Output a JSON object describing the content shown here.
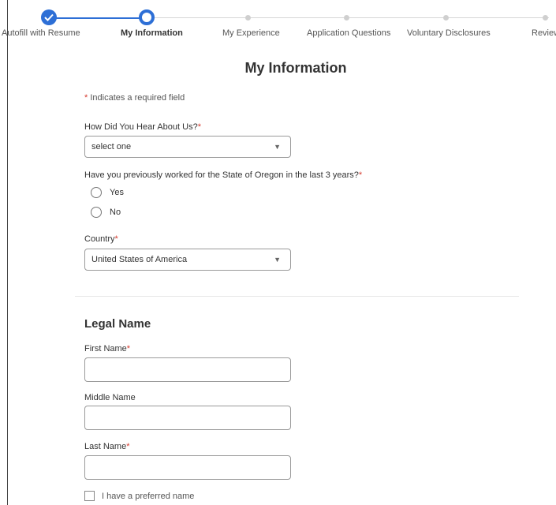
{
  "stepper": {
    "steps": [
      {
        "label": "Autofill with Resume",
        "state": "done"
      },
      {
        "label": "My Information",
        "state": "current"
      },
      {
        "label": "My Experience",
        "state": "upcoming"
      },
      {
        "label": "Application Questions",
        "state": "upcoming"
      },
      {
        "label": "Voluntary Disclosures",
        "state": "upcoming"
      },
      {
        "label": "Review",
        "state": "upcoming"
      }
    ],
    "accent_color": "#2d6fd6"
  },
  "page": {
    "title": "My Information",
    "required_star": "*",
    "required_note": "Indicates a required field"
  },
  "fields": {
    "hear_about": {
      "label": "How Did You Hear About Us?",
      "value": "select one"
    },
    "worked_oregon": {
      "label": "Have you previously worked for the State of Oregon in the last 3 years?",
      "options": [
        "Yes",
        "No"
      ]
    },
    "country": {
      "label": "Country",
      "value": "United States of America"
    }
  },
  "legal_name": {
    "title": "Legal Name",
    "first_name_label": "First Name",
    "middle_name_label": "Middle Name",
    "last_name_label": "Last Name",
    "preferred_name_label": "I have a preferred name"
  }
}
